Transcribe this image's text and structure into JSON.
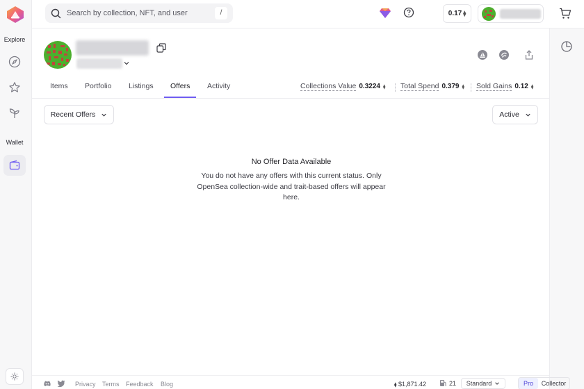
{
  "sidebar": {
    "explore_label": "Explore",
    "wallet_label": "Wallet",
    "items": [
      {
        "icon": "compass-icon"
      },
      {
        "icon": "star-icon"
      },
      {
        "icon": "sprout-icon"
      },
      {
        "icon": "wallet-icon"
      }
    ]
  },
  "search": {
    "placeholder": "Search by collection, NFT, and user",
    "shortcut": "/"
  },
  "header": {
    "balance": "0.17",
    "eth_symbol": "⧫"
  },
  "tabs": [
    "Items",
    "Portfolio",
    "Listings",
    "Offers",
    "Activity"
  ],
  "active_tab": "Offers",
  "stats": [
    {
      "label": "Collections Value",
      "value": "0.3224"
    },
    {
      "label": "Total Spend",
      "value": "0.379"
    },
    {
      "label": "Sold Gains",
      "value": "0.12"
    }
  ],
  "filters": {
    "left": "Recent Offers",
    "right": "Active"
  },
  "empty_state": {
    "title": "No Offer Data Available",
    "description": "You do not have any offers with this current status. Only OpenSea collection-wide and trait-based offers will appear here."
  },
  "footer": {
    "links": [
      "Privacy",
      "Terms",
      "Feedback",
      "Blog"
    ],
    "eth_price": "$1,871.42",
    "gas": "21",
    "mode": "Standard",
    "pro_label": "Pro",
    "collector_label": "Collector"
  },
  "colors": {
    "accent": "#6f5cf1",
    "avatar_green": "#4caf2e",
    "avatar_red": "#c0463c"
  }
}
